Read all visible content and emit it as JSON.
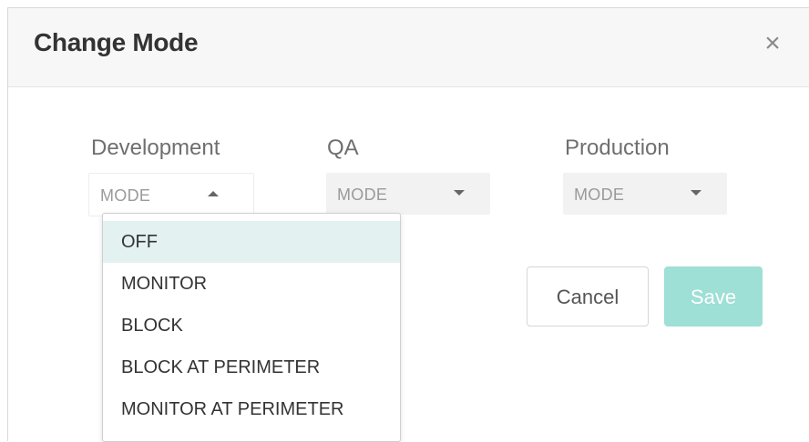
{
  "dialog": {
    "title": "Change Mode",
    "close_icon": "×"
  },
  "environments": [
    {
      "label": "Development",
      "value": "MODE",
      "open": true
    },
    {
      "label": "QA",
      "value": "MODE",
      "open": false
    },
    {
      "label": "Production",
      "value": "MODE",
      "open": false
    }
  ],
  "dropdown": {
    "options": [
      "OFF",
      "MONITOR",
      "BLOCK",
      "BLOCK AT PERIMETER",
      "MONITOR AT PERIMETER"
    ],
    "highlighted_option": "OFF"
  },
  "actions": {
    "cancel_label": "Cancel",
    "save_label": "Save"
  },
  "colors": {
    "save_button_disabled": "#9edfd6",
    "highlight": "#e3f1f1"
  },
  "icons": {
    "close": "close-icon",
    "caret_up": "caret-up-icon",
    "caret_down": "caret-down-icon"
  }
}
